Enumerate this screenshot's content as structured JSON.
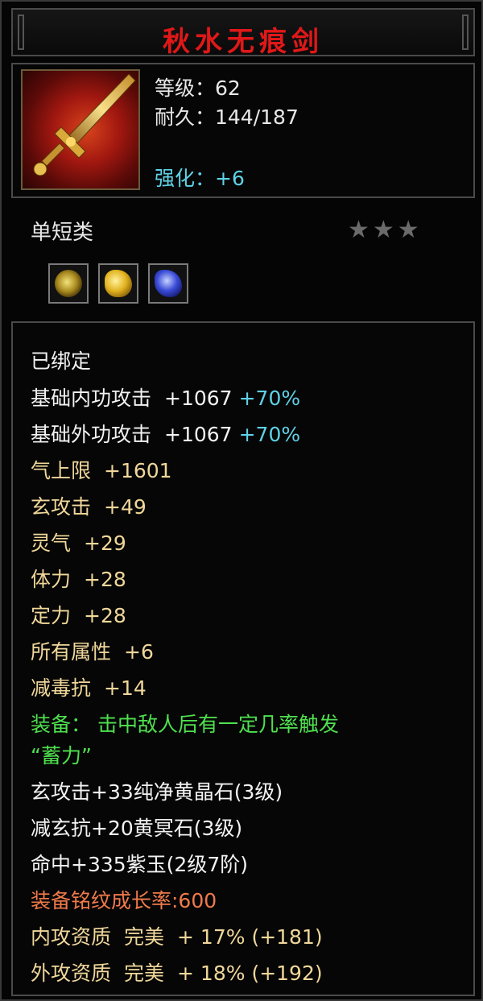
{
  "item": {
    "name": "秋水无痕剑",
    "level": "等级：62",
    "durability": "耐久：144/187",
    "enhance": "强化：+6",
    "type": "单短类",
    "stars": "★★★",
    "icon": "sword-icon"
  },
  "gems": [
    "round-gold-gem-icon",
    "yellow-crystal-gem-icon",
    "purple-jade-gem-icon"
  ],
  "stats": {
    "bound": "已绑定",
    "inner_attack": {
      "label": "基础内功攻击",
      "value": "+1067",
      "pct": "+70%"
    },
    "outer_attack": {
      "label": "基础外功攻击",
      "value": "+1067",
      "pct": "+70%"
    },
    "qi_limit": {
      "label": "气上限",
      "value": "+1601"
    },
    "xuan_attack": {
      "label": "玄攻击",
      "value": "+49"
    },
    "spirit": {
      "label": "灵气",
      "value": "+29"
    },
    "stamina": {
      "label": "体力",
      "value": "+28"
    },
    "focus": {
      "label": "定力",
      "value": "+28"
    },
    "all_attr": {
      "label": "所有属性",
      "value": "+6"
    },
    "poison_res": {
      "label": "减毒抗",
      "value": "+14"
    },
    "equip_effect_1": "装备： 击中敌人后有一定几率触发",
    "equip_effect_2": "“蓄力”",
    "gem_line_1": "玄攻击+33纯净黄晶石(3级)",
    "gem_line_2": "减玄抗+20黄冥石(3级)",
    "gem_line_3": "命中+335紫玉(2级7阶)",
    "growth": "装备铭纹成长率:600",
    "inner_quality": {
      "label": "内攻资质",
      "grade": "完美",
      "value": "+ 17% (+181)"
    },
    "outer_quality": {
      "label": "外攻资质",
      "grade": "完美",
      "value": "+ 18% (+192)"
    }
  },
  "colors": {
    "title": "#e01818",
    "enhance": "#5fd1e6",
    "percent": "#5fd1e6",
    "attribute": "#f0d79a",
    "effect": "#4fe04f",
    "growth": "#f07a4a"
  }
}
